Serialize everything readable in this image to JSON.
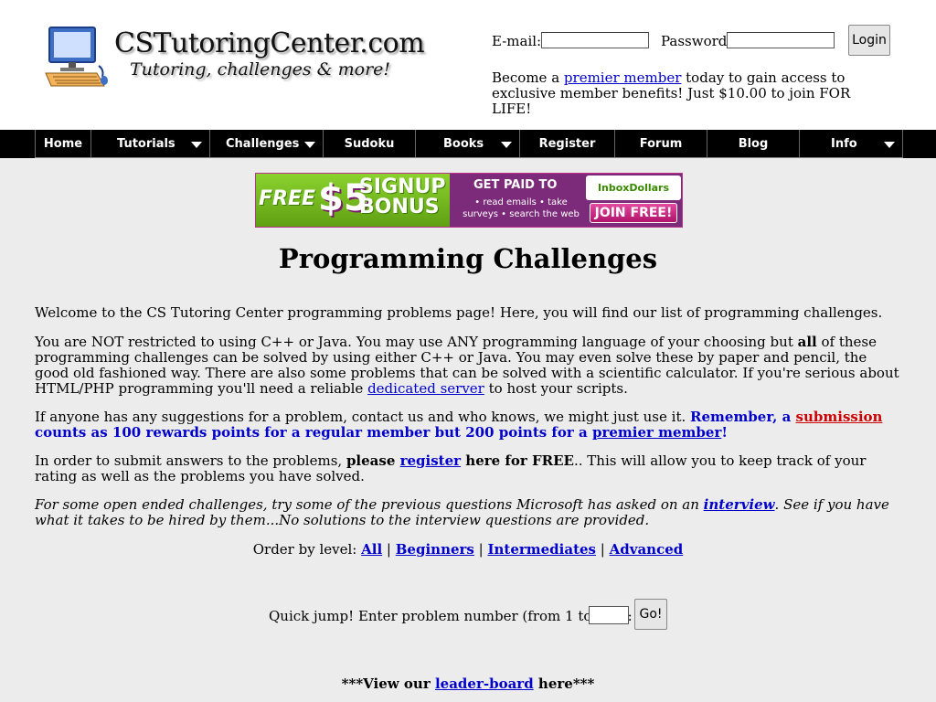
{
  "header": {
    "site_name": "CSTutoringCenter.com",
    "tagline": "Tutoring, challenges & more!",
    "email_label": "E-mail:",
    "password_label": "Password:",
    "email_value": "",
    "password_value": "",
    "login_label": "Login",
    "premier_pre": "Become a ",
    "premier_link": "premier member",
    "premier_post": " today to gain access to exclusive member benefits! Just $10.00 to join FOR LIFE!"
  },
  "nav": {
    "items": [
      {
        "label": "Home"
      },
      {
        "label": "Tutorials"
      },
      {
        "label": "Challenges"
      },
      {
        "label": "Sudoku"
      },
      {
        "label": "Books"
      },
      {
        "label": "Register"
      },
      {
        "label": "Forum"
      },
      {
        "label": "Blog"
      },
      {
        "label": "Info"
      }
    ]
  },
  "banner": {
    "free": "FREE",
    "amount": "$5",
    "signup": "SIGNUP",
    "bonus": "BONUS",
    "get_paid": "GET PAID TO",
    "sub": "• read emails • take surveys • search the web",
    "brand": "InboxDollars",
    "join": "JOIN FREE!"
  },
  "main": {
    "title": "Programming Challenges",
    "p1": "Welcome to the CS Tutoring Center programming problems page! Here, you will find our list of programming challenges.",
    "p2_a": "You are NOT restricted to using C++ or Java. You may use ANY programming language of your choosing but ",
    "p2_bold": "all",
    "p2_b": " of these programming challenges can be solved by using either C++ or Java. You may even solve these by paper and pencil, the good old fashioned way. There are also some problems that can be solved with a scientific calculator. If you're serious about HTML/PHP programming you'll need a reliable ",
    "p2_link": "dedicated server",
    "p2_c": " to host your scripts.",
    "p3_a": "If anyone has any suggestions for a problem, contact us and who knows, we might just use it. ",
    "p3_blue_a": "Remember, a ",
    "p3_red_link": "submission",
    "p3_blue_b": " counts as 100 rewards points for a regular member but 200 points for a ",
    "p3_link": "premier member",
    "p3_blue_c": "!",
    "p4_a": "In order to submit answers to the problems, ",
    "p4_bold_a": "please ",
    "p4_link": "register",
    "p4_bold_b": " here for FREE",
    "p4_b": ".. This will allow you to keep track of your rating as well as the problems you have solved.",
    "p5_a": "For some open ended challenges, try some of the previous questions Microsoft has asked on an ",
    "p5_link": "interview",
    "p5_b": ". See if you have what it takes to be hired by them...No solutions to the interview questions are provided.",
    "order_label": "Order by level: ",
    "order_all": "All",
    "order_beginners": "Beginners",
    "order_intermediates": "Intermediates",
    "order_advanced": "Advanced",
    "sep": " | ",
    "quick_jump_label": "Quick jump! Enter problem number (from 1 to 126):",
    "quick_jump_value": "",
    "go_label": "Go!",
    "leader_a": "***View our ",
    "leader_link": "leader-board",
    "leader_b": " here***"
  },
  "colors": {
    "background": "#ececec",
    "link": "#0000cc",
    "highlight_blue": "#0000cc",
    "highlight_red": "#cc0000",
    "nav_bg": "#000000"
  }
}
